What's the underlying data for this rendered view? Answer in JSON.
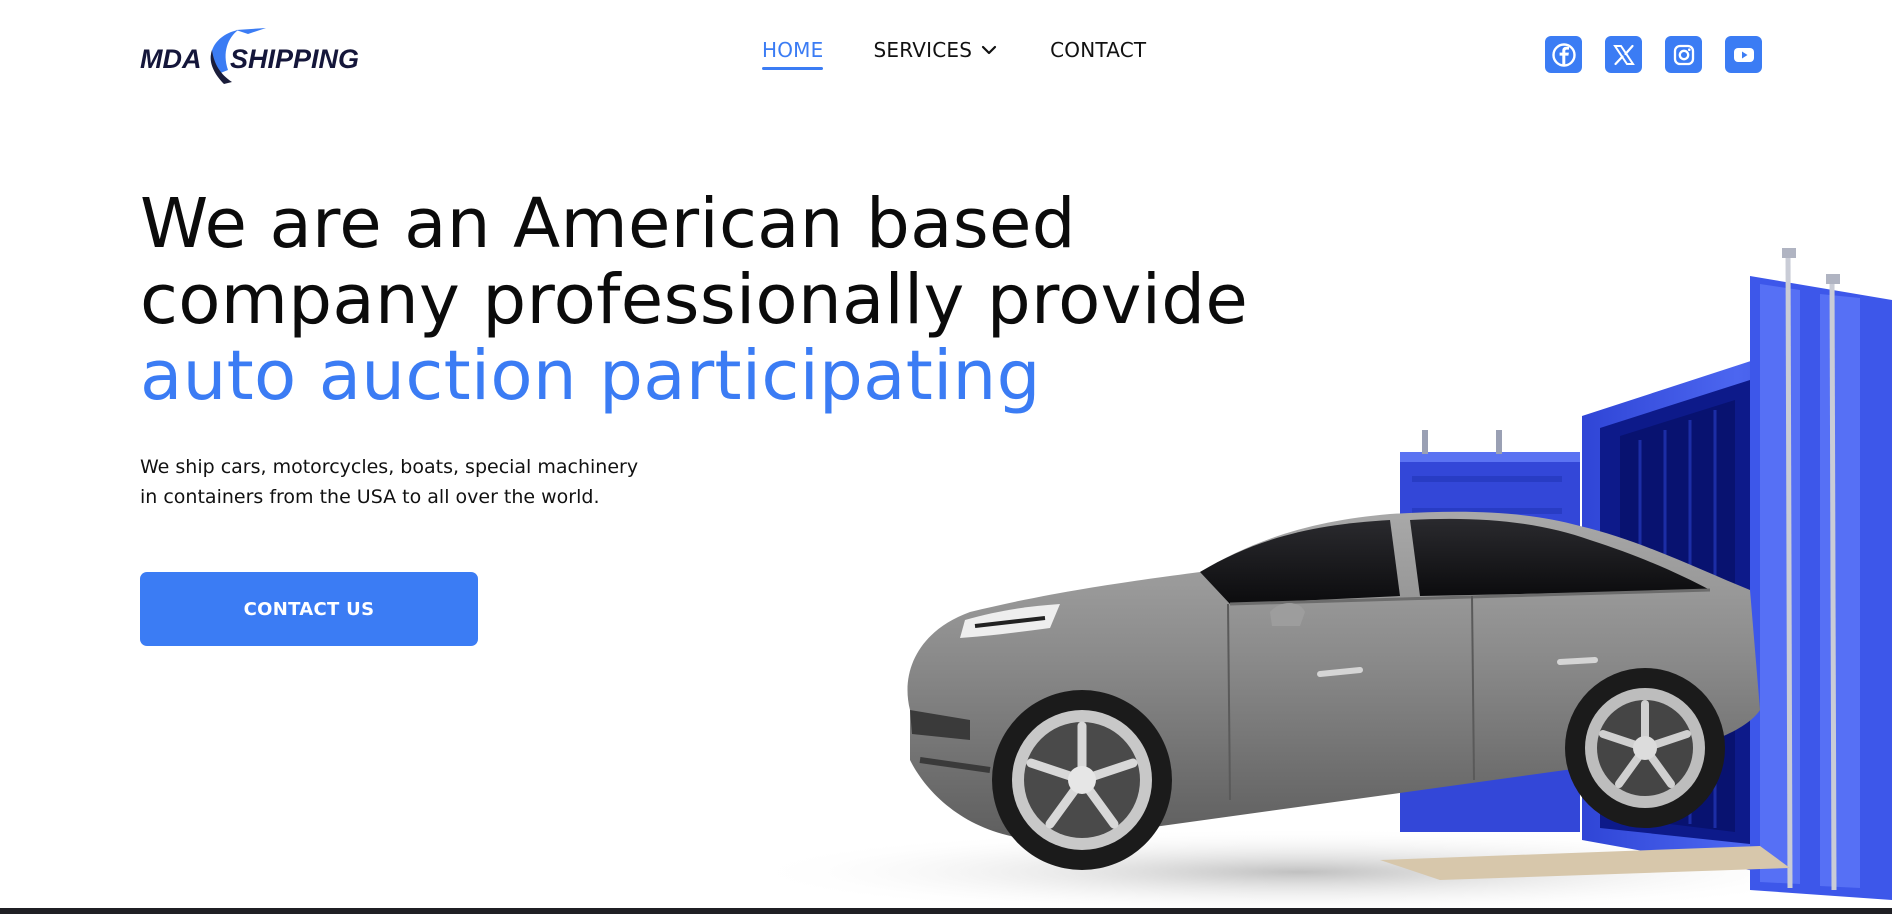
{
  "brand": {
    "logo_left": "MDA",
    "logo_right": "SHIPPING"
  },
  "nav": {
    "home": "HOME",
    "services": "SERVICES",
    "contact": "CONTACT",
    "active": "home"
  },
  "social": [
    {
      "icon": "facebook-icon"
    },
    {
      "icon": "x-twitter-icon"
    },
    {
      "icon": "instagram-icon"
    },
    {
      "icon": "youtube-icon"
    }
  ],
  "hero": {
    "title_line1": "We are an American based",
    "title_line2": "company professionally provide",
    "title_accent": "auto auction participating",
    "desc_line1": "We ship cars, motorcycles, boats, special machinery",
    "desc_line2": "in containers from the USA to all over the world.",
    "cta": "CONTACT US"
  },
  "colors": {
    "accent": "#3b7cf4",
    "text": "#0b0b0b",
    "background": "#ffffff",
    "container": "#3c56e8",
    "car": "#7d7d7d"
  }
}
